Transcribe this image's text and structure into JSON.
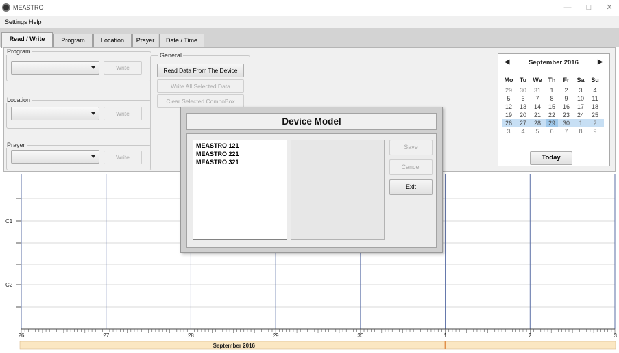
{
  "window": {
    "title": "MEASTRO",
    "minimize": "—",
    "maximize": "□",
    "close": "✕"
  },
  "menu": [
    "Settings",
    "Help"
  ],
  "tabs": [
    "Read / Write",
    "Program",
    "Location",
    "Prayer",
    "Date / Time"
  ],
  "program": {
    "label": "Program",
    "value": "",
    "write_label": "Write"
  },
  "location": {
    "label": "Location",
    "value": "",
    "write_label": "Write"
  },
  "prayer": {
    "label": "Prayer",
    "value": "",
    "write_label": "Write"
  },
  "general": {
    "label": "General",
    "read_button": "Read Data From The Device",
    "write_all_button": "Write All Selected Data",
    "clear_button": "Clear Selected ComboBox"
  },
  "calendar": {
    "prev": "◀",
    "next": "▶",
    "month_label": "September 2016",
    "dow": [
      "Mo",
      "Tu",
      "We",
      "Th",
      "Fr",
      "Sa",
      "Su"
    ],
    "weeks": [
      [
        "29",
        "30",
        "31",
        "1",
        "2",
        "3",
        "4"
      ],
      [
        "5",
        "6",
        "7",
        "8",
        "9",
        "10",
        "11"
      ],
      [
        "12",
        "13",
        "14",
        "15",
        "16",
        "17",
        "18"
      ],
      [
        "19",
        "20",
        "21",
        "22",
        "23",
        "24",
        "25"
      ],
      [
        "26",
        "27",
        "28",
        "29",
        "30",
        "1",
        "2"
      ],
      [
        "3",
        "4",
        "5",
        "6",
        "7",
        "8",
        "9"
      ]
    ],
    "highlighted_week": 4,
    "selected_day": "29",
    "today_button": "Today"
  },
  "chart": {
    "row_labels": [
      "C1",
      "C2"
    ],
    "x_ticks": [
      "26",
      "27",
      "28",
      "29",
      "30",
      "1",
      "2",
      "3"
    ],
    "band_label": "September 2016"
  },
  "modal": {
    "title": "Device Model",
    "devices": [
      "MEASTRO 121",
      "MEASTRO 221",
      "MEASTRO 321"
    ],
    "save_label": "Save",
    "cancel_label": "Cancel",
    "exit_label": "Exit"
  },
  "colors": {
    "week_highlight": "#c7dff4",
    "selected_day": "#9fc8ea",
    "chart_band": "#fbe7c2",
    "chart_marker": "#e0904a",
    "chart_vline": "#5b6fa6"
  }
}
